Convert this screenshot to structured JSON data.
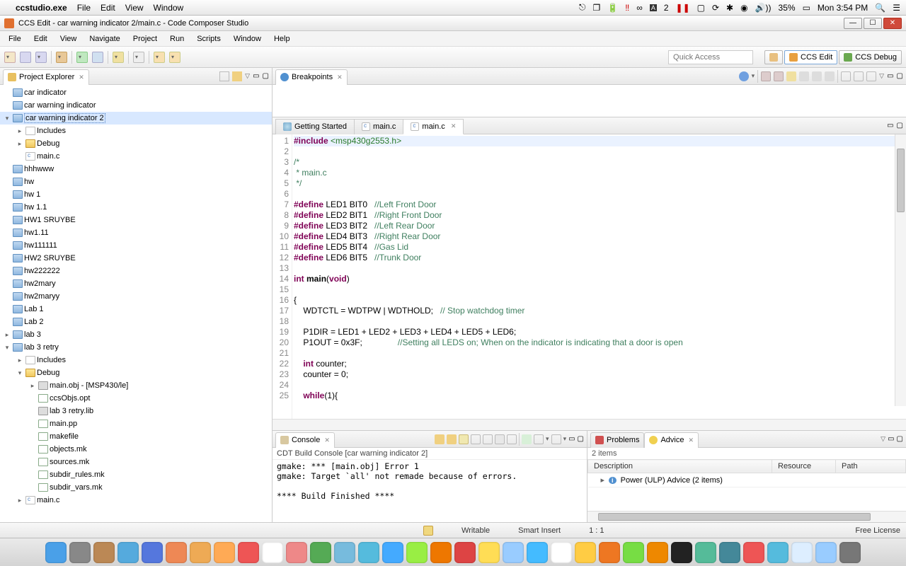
{
  "mac": {
    "app": "ccstudio.exe",
    "menus": [
      "File",
      "Edit",
      "View",
      "Window"
    ],
    "battery": "35%",
    "clock": "Mon 3:54 PM"
  },
  "window": {
    "title": "CCS Edit - car warning indicator 2/main.c - Code Composer Studio"
  },
  "app_menu": [
    "File",
    "Edit",
    "View",
    "Navigate",
    "Project",
    "Run",
    "Scripts",
    "Window",
    "Help"
  ],
  "quick_access_placeholder": "Quick Access",
  "perspectives": {
    "edit": "CCS Edit",
    "debug": "CCS Debug"
  },
  "project_explorer": {
    "title": "Project Explorer",
    "roots": [
      {
        "l": "car indicator",
        "t": "proj",
        "d": 0,
        "tw": ""
      },
      {
        "l": "car warning indicator",
        "t": "proj",
        "d": 0,
        "tw": ""
      },
      {
        "l": "car warning indicator 2",
        "t": "proj",
        "d": 0,
        "tw": "▾",
        "sel": true
      },
      {
        "l": "Includes",
        "t": "inc",
        "d": 1,
        "tw": "▸"
      },
      {
        "l": "Debug",
        "t": "folder-open",
        "d": 1,
        "tw": "▸"
      },
      {
        "l": "main.c",
        "t": "cfile",
        "d": 1,
        "tw": ""
      },
      {
        "l": "hhhwww",
        "t": "proj",
        "d": 0,
        "tw": ""
      },
      {
        "l": "hw",
        "t": "proj",
        "d": 0,
        "tw": ""
      },
      {
        "l": "hw 1",
        "t": "proj",
        "d": 0,
        "tw": ""
      },
      {
        "l": "hw 1.1",
        "t": "proj",
        "d": 0,
        "tw": ""
      },
      {
        "l": "HW1 SRUYBE",
        "t": "proj",
        "d": 0,
        "tw": ""
      },
      {
        "l": "hw1.11",
        "t": "proj",
        "d": 0,
        "tw": ""
      },
      {
        "l": "hw111111",
        "t": "proj",
        "d": 0,
        "tw": ""
      },
      {
        "l": "HW2 SRUYBE",
        "t": "proj",
        "d": 0,
        "tw": ""
      },
      {
        "l": "hw222222",
        "t": "proj",
        "d": 0,
        "tw": ""
      },
      {
        "l": "hw2mary",
        "t": "proj",
        "d": 0,
        "tw": ""
      },
      {
        "l": "hw2maryy",
        "t": "proj",
        "d": 0,
        "tw": ""
      },
      {
        "l": "Lab 1",
        "t": "proj",
        "d": 0,
        "tw": ""
      },
      {
        "l": "Lab 2",
        "t": "proj",
        "d": 0,
        "tw": ""
      },
      {
        "l": "lab 3",
        "t": "proj",
        "d": 0,
        "tw": "▸"
      },
      {
        "l": "lab 3 retry",
        "t": "proj",
        "d": 0,
        "tw": "▾"
      },
      {
        "l": "Includes",
        "t": "inc",
        "d": 1,
        "tw": "▸"
      },
      {
        "l": "Debug",
        "t": "folder-open",
        "d": 1,
        "tw": "▾"
      },
      {
        "l": "main.obj - [MSP430/le]",
        "t": "obj",
        "d": 2,
        "tw": "▸"
      },
      {
        "l": "ccsObjs.opt",
        "t": "mk",
        "d": 2,
        "tw": ""
      },
      {
        "l": "lab 3 retry.lib",
        "t": "obj",
        "d": 2,
        "tw": ""
      },
      {
        "l": "main.pp",
        "t": "mk",
        "d": 2,
        "tw": ""
      },
      {
        "l": "makefile",
        "t": "mk",
        "d": 2,
        "tw": ""
      },
      {
        "l": "objects.mk",
        "t": "mk",
        "d": 2,
        "tw": ""
      },
      {
        "l": "sources.mk",
        "t": "mk",
        "d": 2,
        "tw": ""
      },
      {
        "l": "subdir_rules.mk",
        "t": "mk",
        "d": 2,
        "tw": ""
      },
      {
        "l": "subdir_vars.mk",
        "t": "mk",
        "d": 2,
        "tw": ""
      },
      {
        "l": "main.c",
        "t": "cfile",
        "d": 1,
        "tw": "▸"
      }
    ]
  },
  "breakpoints": {
    "title": "Breakpoints"
  },
  "editor": {
    "tabs": [
      {
        "label": "Getting Started",
        "icon": "globe",
        "active": false
      },
      {
        "label": "main.c",
        "icon": "cfile",
        "active": false
      },
      {
        "label": "main.c",
        "icon": "cfile",
        "active": true
      }
    ],
    "lines": [
      {
        "n": 1,
        "html": "<span class='pp'>#include</span> <span class='inc'>&lt;msp430g2553.h&gt;</span>",
        "hl": true
      },
      {
        "n": 2,
        "html": ""
      },
      {
        "n": 3,
        "html": "<span class='cmt'>/*</span>"
      },
      {
        "n": 4,
        "html": "<span class='cmt'> * main.c</span>"
      },
      {
        "n": 5,
        "html": "<span class='cmt'> */</span>"
      },
      {
        "n": 6,
        "html": ""
      },
      {
        "n": 7,
        "html": "<span class='pp'>#define</span> LED1 BIT0   <span class='cmt'>//Left Front Door</span>"
      },
      {
        "n": 8,
        "html": "<span class='pp'>#define</span> LED2 BIT1   <span class='cmt'>//Right Front Door</span>"
      },
      {
        "n": 9,
        "html": "<span class='pp'>#define</span> LED3 BIT2   <span class='cmt'>//Left Rear Door</span>"
      },
      {
        "n": 10,
        "html": "<span class='pp'>#define</span> LED4 BIT3   <span class='cmt'>//Right Rear Door</span>"
      },
      {
        "n": 11,
        "html": "<span class='pp'>#define</span> LED5 BIT4   <span class='cmt'>//Gas Lid</span>"
      },
      {
        "n": 12,
        "html": "<span class='pp'>#define</span> LED6 BIT5   <span class='cmt'>//Trunk Door</span>"
      },
      {
        "n": 13,
        "html": ""
      },
      {
        "n": 14,
        "html": "<span class='kw'>int</span> <span style='font-weight:bold'>main</span>(<span class='kw'>void</span>)"
      },
      {
        "n": 15,
        "html": ""
      },
      {
        "n": 16,
        "html": "{"
      },
      {
        "n": 17,
        "html": "    WDTCTL = WDTPW | WDTHOLD;   <span class='cmt'>// Stop watchdog timer</span>"
      },
      {
        "n": 18,
        "html": ""
      },
      {
        "n": 19,
        "html": "    P1DIR = LED1 + LED2 + LED3 + LED4 + LED5 + LED6;"
      },
      {
        "n": 20,
        "html": "    P1OUT = 0x3F;               <span class='cmt'>//Setting all LEDS on; When on the indicator is indicating that a door is open</span>"
      },
      {
        "n": 21,
        "html": ""
      },
      {
        "n": 22,
        "html": "    <span class='kw'>int</span> counter;"
      },
      {
        "n": 23,
        "html": "    counter = 0;"
      },
      {
        "n": 24,
        "html": ""
      },
      {
        "n": 25,
        "html": "    <span class='kw'>while</span>(1){"
      }
    ]
  },
  "console": {
    "title": "Console",
    "subtitle": "CDT Build Console [car warning indicator 2]",
    "body": "gmake: *** [main.obj] Error 1\ngmake: Target `all' not remade because of errors.\n\n**** Build Finished ****"
  },
  "advice": {
    "tabs": {
      "problems": "Problems",
      "advice": "Advice"
    },
    "count": "2 items",
    "cols": [
      "Description",
      "Resource",
      "Path"
    ],
    "rows": [
      {
        "desc": "Power (ULP) Advice (2 items)",
        "res": "",
        "path": "",
        "exp": "▸",
        "icon": "i"
      }
    ]
  },
  "status": {
    "writable": "Writable",
    "insert": "Smart Insert",
    "pos": "1 : 1",
    "license": "Free License"
  },
  "dock_count": 34
}
